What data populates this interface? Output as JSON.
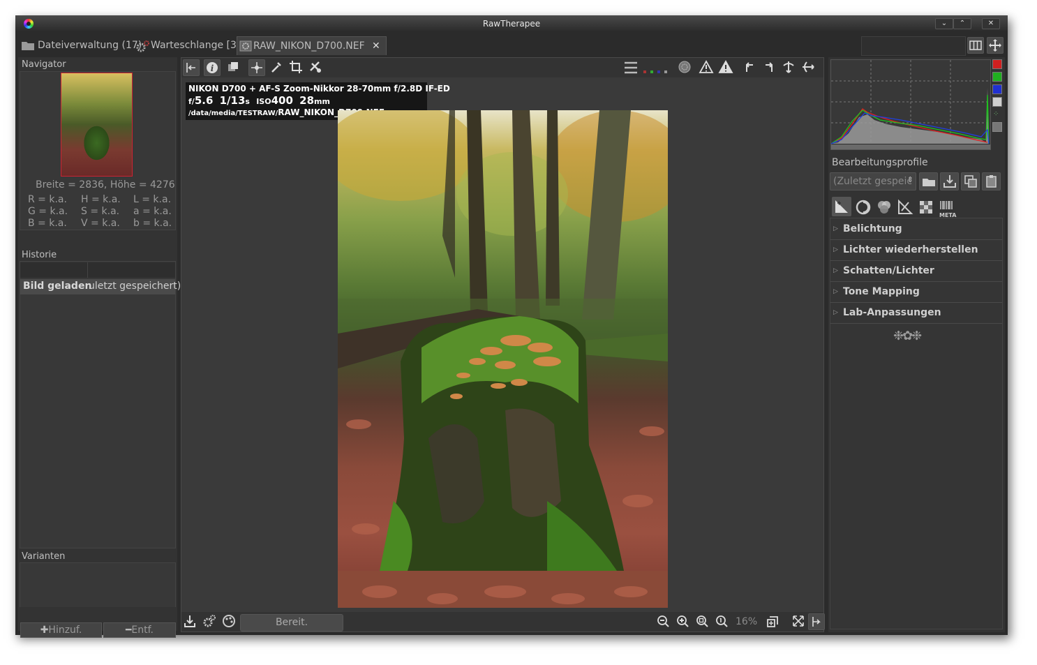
{
  "window": {
    "title": "RawTherapee",
    "minimize_label": "⌄",
    "maximize_label": "⌃",
    "close_label": "✕"
  },
  "tabs": [
    {
      "label": "Dateiverwaltung (17)",
      "icon": "folder-icon"
    },
    {
      "label": "Warteschlange [3]",
      "icon": "gears-icon"
    },
    {
      "label": "RAW_NIKON_D700.NEF",
      "icon": "image-icon",
      "close": "✕"
    }
  ],
  "navigator": {
    "title": "Navigator",
    "dimensions": "Breite = 2836, Höhe = 4276",
    "values": [
      [
        "R = k.a.",
        "H = k.a.",
        "L = k.a."
      ],
      [
        "G = k.a.",
        "S = k.a.",
        "a = k.a."
      ],
      [
        "B = k.a.",
        "V = k.a.",
        "b = k.a."
      ]
    ]
  },
  "history": {
    "title": "Historie",
    "row_col1": "Bild geladen",
    "row_col2": "uletzt gespeichert)"
  },
  "variants": {
    "title": "Varianten",
    "add_label": "Hinzuf.",
    "remove_label": "Entf."
  },
  "exif": {
    "line1": "NIKON D700 + AF-S Zoom-Nikkor 28-70mm f/2.8D IF-ED",
    "aperture_prefix": "f/",
    "aperture": "5.6",
    "shutter": "1/13",
    "shutter_unit": "s",
    "iso_prefix": "ISO",
    "iso": "400",
    "focal": "28",
    "focal_unit": "mm",
    "path_prefix": "/data/media/TESTRAW/",
    "filename": "RAW_NIKON_D700.NEF"
  },
  "statusbar": {
    "status": "Bereit.",
    "zoom": "16%"
  },
  "profiles": {
    "title": "Bearbeitungsprofile",
    "selected": "(Zuletzt gespeic"
  },
  "tools": [
    {
      "label": "Belichtung"
    },
    {
      "label": "Lichter wiederherstellen"
    },
    {
      "label": "Schatten/Lichter"
    },
    {
      "label": "Tone Mapping"
    },
    {
      "label": "Lab-Anpassungen"
    }
  ],
  "tool_tabs": [
    "exposure-tab-icon",
    "detail-tab-icon",
    "color-tab-icon",
    "transform-tab-icon",
    "raw-tab-icon",
    "meta-tab-icon"
  ],
  "meta_tab_label": "META",
  "histogram_colors": {
    "red": "#e02020",
    "green": "#20c020",
    "blue": "#2040e0",
    "luminance": "#cfcfcf"
  },
  "accent_colors": {
    "background": "#2b2b2b",
    "panel": "#383838",
    "nav_frame": "#cc2233"
  }
}
